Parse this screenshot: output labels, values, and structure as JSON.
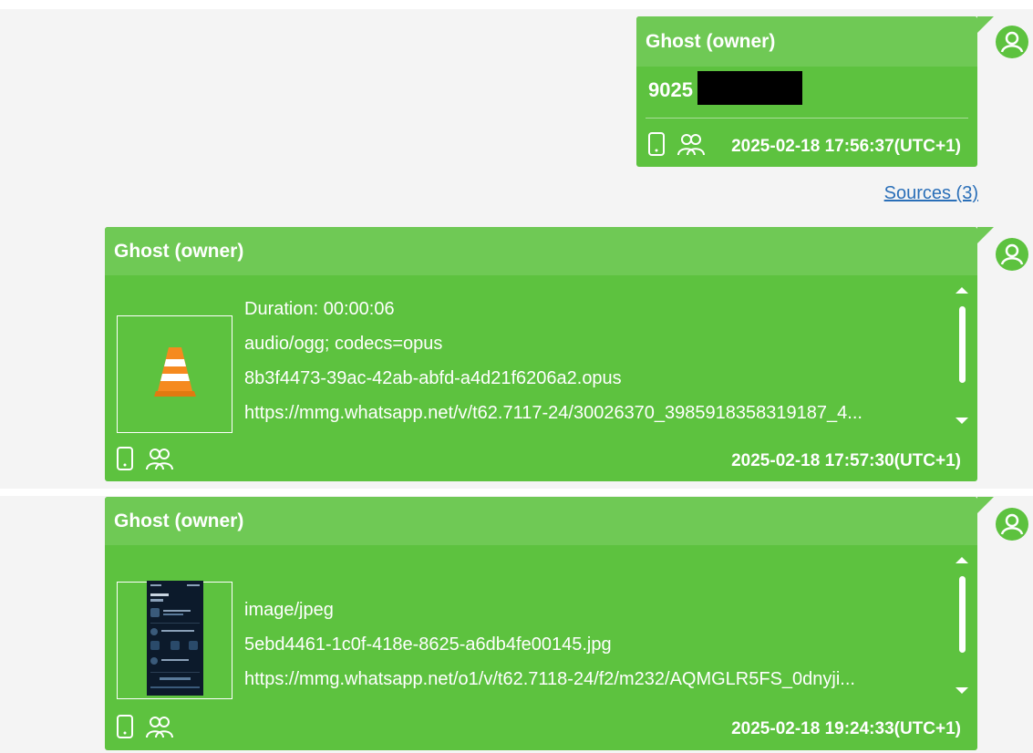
{
  "colors": {
    "bubble": "#5dc23f",
    "bubble_header": "#6fc955",
    "text": "#ffffff",
    "link": "#2a6fb8",
    "background": "#f4f4f4"
  },
  "messages": [
    {
      "sender": "Ghost (owner)",
      "number": "9025",
      "timestamp": "2025-02-18 17:56:37(UTC+1)",
      "icons": [
        "phone-icon",
        "group-icon"
      ],
      "sources_link": "Sources (3)"
    },
    {
      "sender": "Ghost (owner)",
      "thumbnail": "vlc-cone-icon",
      "lines": [
        "Duration: 00:00:06",
        "audio/ogg; codecs=opus",
        "8b3f4473-39ac-42ab-abfd-a4d21f6206a2.opus",
        "https://mmg.whatsapp.net/v/t62.7117-24/30026370_3985918358319187_4..."
      ],
      "timestamp": "2025-02-18 17:57:30(UTC+1)",
      "icons": [
        "phone-icon",
        "group-icon"
      ]
    },
    {
      "sender": "Ghost (owner)",
      "thumbnail": "screenshot-thumbnail",
      "lines": [
        "image/jpeg",
        "5ebd4461-1c0f-418e-8625-a6db4fe00145.jpg",
        "https://mmg.whatsapp.net/o1/v/t62.7118-24/f2/m232/AQMGLR5FS_0dnyji..."
      ],
      "timestamp": "2025-02-18 19:24:33(UTC+1)",
      "icons": [
        "phone-icon",
        "group-icon"
      ]
    }
  ]
}
